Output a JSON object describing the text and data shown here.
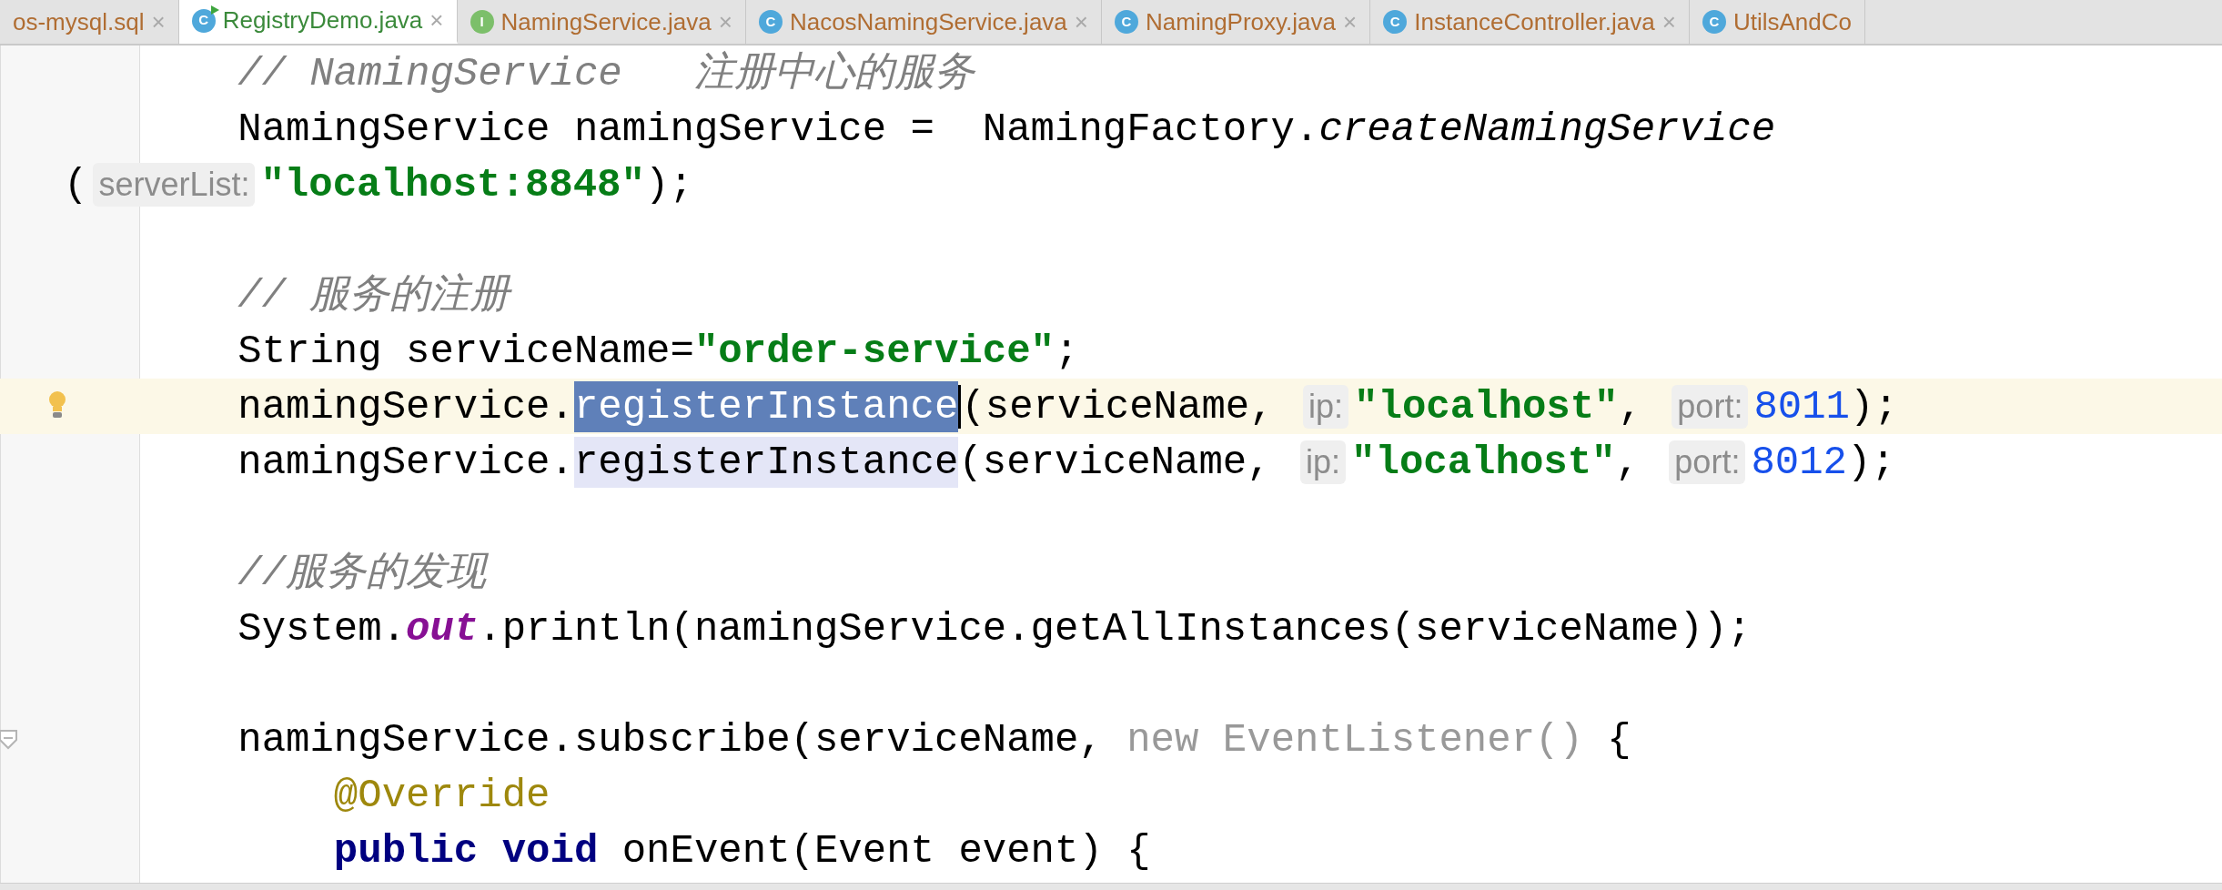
{
  "tabs": [
    {
      "label": "os-mysql.sql",
      "close": "×",
      "selected": false
    },
    {
      "label": "RegistryDemo.java",
      "icon_letter": "C",
      "runnable": true,
      "close": "×",
      "selected": true
    },
    {
      "label": "NamingService.java",
      "icon_letter": "I",
      "runnable": false,
      "close": "×",
      "selected": false
    },
    {
      "label": "NacosNamingService.java",
      "icon_letter": "C",
      "runnable": false,
      "close": "×",
      "selected": false
    },
    {
      "label": "NamingProxy.java",
      "icon_letter": "C",
      "runnable": false,
      "close": "×",
      "selected": false
    },
    {
      "label": "InstanceController.java",
      "icon_letter": "C",
      "runnable": false,
      "close": "×",
      "selected": false
    },
    {
      "label": "UtilsAndCo",
      "icon_letter": "C",
      "runnable": false,
      "selected": false
    }
  ],
  "editor": {
    "lines": [
      {
        "kind": "code",
        "current": false,
        "tokens": [
          {
            "text": "        // NamingService   注册中心的服务",
            "kind": "comment"
          }
        ]
      },
      {
        "kind": "code",
        "current": false,
        "tokens": [
          {
            "text": "        NamingService namingService =  NamingFactory.",
            "kind": "plain"
          },
          {
            "text": "createNamingService",
            "kind": "italic"
          }
        ]
      },
      {
        "kind": "wrap",
        "current": false,
        "tokens": [
          {
            "text": "(",
            "kind": "plain"
          },
          {
            "text": "serverList:",
            "kind": "hint"
          },
          {
            "text": "\"localhost:8848\"",
            "kind": "string"
          },
          {
            "text": ");",
            "kind": "plain"
          }
        ]
      },
      {
        "kind": "blank",
        "current": false
      },
      {
        "kind": "code",
        "current": false,
        "tokens": [
          {
            "text": "        // 服务的注册",
            "kind": "comment"
          }
        ]
      },
      {
        "kind": "code",
        "current": false,
        "tokens": [
          {
            "text": "        String serviceName=",
            "kind": "plain"
          },
          {
            "text": "\"order-service\"",
            "kind": "string"
          },
          {
            "text": ";",
            "kind": "plain"
          }
        ]
      },
      {
        "kind": "code",
        "current": true,
        "bulb": true,
        "tokens": [
          {
            "text": "        namingService.",
            "kind": "plain"
          },
          {
            "text": "registerInstance",
            "kind": "selection"
          },
          {
            "text": "(serviceName, ",
            "kind": "plain"
          },
          {
            "text": "ip:",
            "kind": "hint"
          },
          {
            "text": "\"localhost\"",
            "kind": "string"
          },
          {
            "text": ", ",
            "kind": "plain"
          },
          {
            "text": "port:",
            "kind": "hint"
          },
          {
            "text": "8011",
            "kind": "number"
          },
          {
            "text": ");",
            "kind": "plain"
          }
        ]
      },
      {
        "kind": "code",
        "current": false,
        "tokens": [
          {
            "text": "        namingService.",
            "kind": "plain"
          },
          {
            "text": "registerInstance",
            "kind": "usage"
          },
          {
            "text": "(serviceName, ",
            "kind": "plain"
          },
          {
            "text": "ip:",
            "kind": "hint"
          },
          {
            "text": "\"localhost\"",
            "kind": "string"
          },
          {
            "text": ", ",
            "kind": "plain"
          },
          {
            "text": "port:",
            "kind": "hint"
          },
          {
            "text": "8012",
            "kind": "number"
          },
          {
            "text": ");",
            "kind": "plain"
          }
        ]
      },
      {
        "kind": "blank",
        "current": false
      },
      {
        "kind": "code",
        "current": false,
        "tokens": [
          {
            "text": "        //服务的发现",
            "kind": "comment"
          }
        ]
      },
      {
        "kind": "code",
        "current": false,
        "tokens": [
          {
            "text": "        System.",
            "kind": "plain"
          },
          {
            "text": "out",
            "kind": "static"
          },
          {
            "text": ".println(namingService.getAllInstances(serviceName));",
            "kind": "plain"
          }
        ]
      },
      {
        "kind": "blank",
        "current": false
      },
      {
        "kind": "code",
        "current": false,
        "fold": true,
        "tokens": [
          {
            "text": "        namingService.subscribe(serviceName, ",
            "kind": "plain"
          },
          {
            "text": "new EventListener()",
            "kind": "unused"
          },
          {
            "text": " {",
            "kind": "plain"
          }
        ]
      },
      {
        "kind": "code",
        "current": false,
        "tokens": [
          {
            "text": "            @Override",
            "kind": "annotation"
          }
        ]
      },
      {
        "kind": "code",
        "current": false,
        "tokens": [
          {
            "text": "            public void",
            "kind": "keyword"
          },
          {
            "text": " onEvent(Event event) {",
            "kind": "plain"
          }
        ]
      }
    ]
  }
}
